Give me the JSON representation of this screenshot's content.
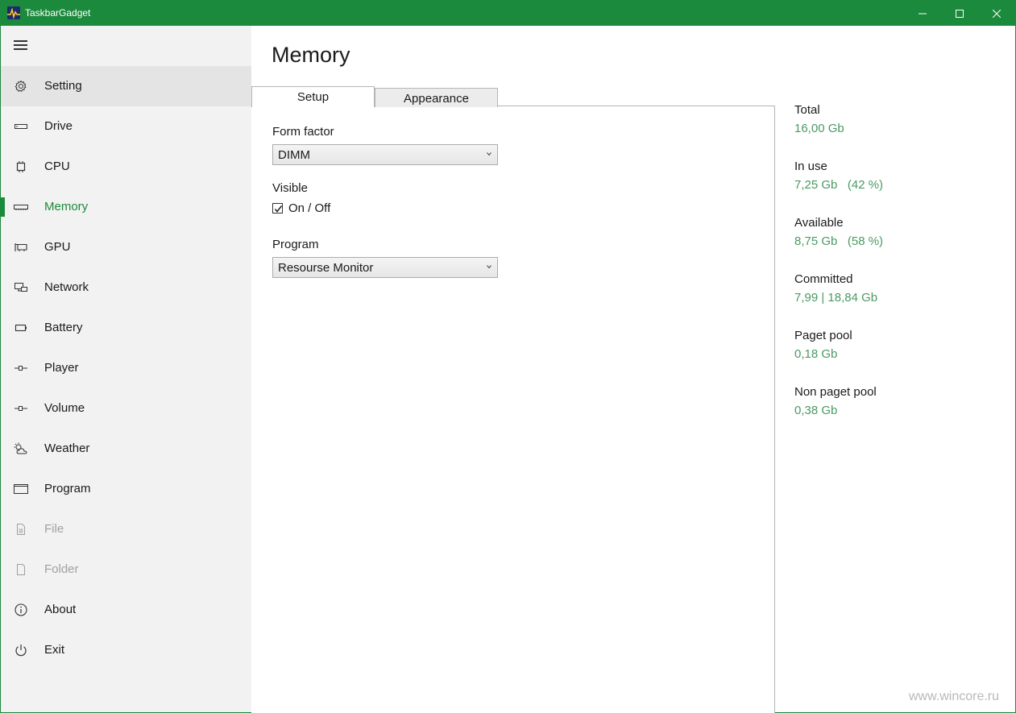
{
  "window": {
    "title": "TaskbarGadget",
    "accent": "#1b8a3c"
  },
  "sidebar": {
    "items": [
      {
        "label": "Setting",
        "icon": "gear-icon",
        "state": "selected"
      },
      {
        "label": "Drive",
        "icon": "drive-icon",
        "state": "normal"
      },
      {
        "label": "CPU",
        "icon": "cpu-icon",
        "state": "normal"
      },
      {
        "label": "Memory",
        "icon": "memory-icon",
        "state": "active"
      },
      {
        "label": "GPU",
        "icon": "gpu-icon",
        "state": "normal"
      },
      {
        "label": "Network",
        "icon": "network-icon",
        "state": "normal"
      },
      {
        "label": "Battery",
        "icon": "battery-icon",
        "state": "normal"
      },
      {
        "label": "Player",
        "icon": "slider-icon",
        "state": "normal"
      },
      {
        "label": "Volume",
        "icon": "slider-icon",
        "state": "normal"
      },
      {
        "label": "Weather",
        "icon": "weather-icon",
        "state": "normal"
      },
      {
        "label": "Program",
        "icon": "window-icon",
        "state": "normal"
      },
      {
        "label": "File",
        "icon": "file-icon",
        "state": "disabled"
      },
      {
        "label": "Folder",
        "icon": "folder-icon",
        "state": "disabled"
      },
      {
        "label": "About",
        "icon": "info-icon",
        "state": "normal"
      },
      {
        "label": "Exit",
        "icon": "power-icon",
        "state": "normal"
      }
    ]
  },
  "main": {
    "title": "Memory",
    "tabs": [
      {
        "label": "Setup",
        "selected": true
      },
      {
        "label": "Appearance",
        "selected": false
      }
    ],
    "form_factor": {
      "label": "Form factor",
      "value": "DIMM"
    },
    "visible": {
      "label": "Visible",
      "checkbox_label": "On / Off",
      "checked": true
    },
    "program": {
      "label": "Program",
      "value": "Resourse Monitor"
    }
  },
  "stats": [
    {
      "label": "Total",
      "value": "16,00 Gb"
    },
    {
      "label": "In use",
      "value": "7,25 Gb   (42 %)"
    },
    {
      "label": "Available",
      "value": "8,75 Gb   (58 %)"
    },
    {
      "label": "Committed",
      "value": "7,99 | 18,84 Gb"
    },
    {
      "label": "Paget pool",
      "value": "0,18 Gb"
    },
    {
      "label": "Non paget pool",
      "value": "0,38 Gb"
    }
  ],
  "watermark": "www.wincore.ru"
}
